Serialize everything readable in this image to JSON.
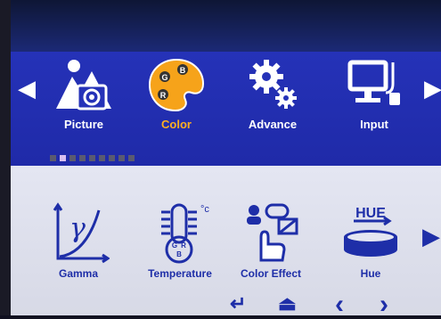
{
  "categories": [
    {
      "label": "Picture",
      "icon": "picture-icon",
      "active": false
    },
    {
      "label": "Color",
      "icon": "palette-icon",
      "active": true
    },
    {
      "label": "Advance",
      "icon": "gears-icon",
      "active": false
    },
    {
      "label": "Input",
      "icon": "monitor-input-icon",
      "active": false
    }
  ],
  "palette_letters": [
    "G",
    "B",
    "R"
  ],
  "page_indicator": {
    "count": 9,
    "current": 2
  },
  "sub_items": [
    {
      "label": "Gamma",
      "glyph": "γ",
      "icon": "gamma-curve-icon"
    },
    {
      "label": "Temperature",
      "unit": "°c",
      "letters": [
        "G",
        "R",
        "B"
      ],
      "icon": "thermometer-icon"
    },
    {
      "label": "Color Effect",
      "icon": "color-effect-icon"
    },
    {
      "label": "Hue",
      "caption": "HUE",
      "icon": "hue-icon"
    }
  ],
  "nav_glyphs": {
    "enter": "↵",
    "exit": "⏏",
    "prev": "‹",
    "next": "›"
  },
  "colors": {
    "band_blue": "#2230b4",
    "active_orange": "#f6a31a",
    "label_blue": "#1e2ea8",
    "panel_grey": "#dcdee9"
  }
}
